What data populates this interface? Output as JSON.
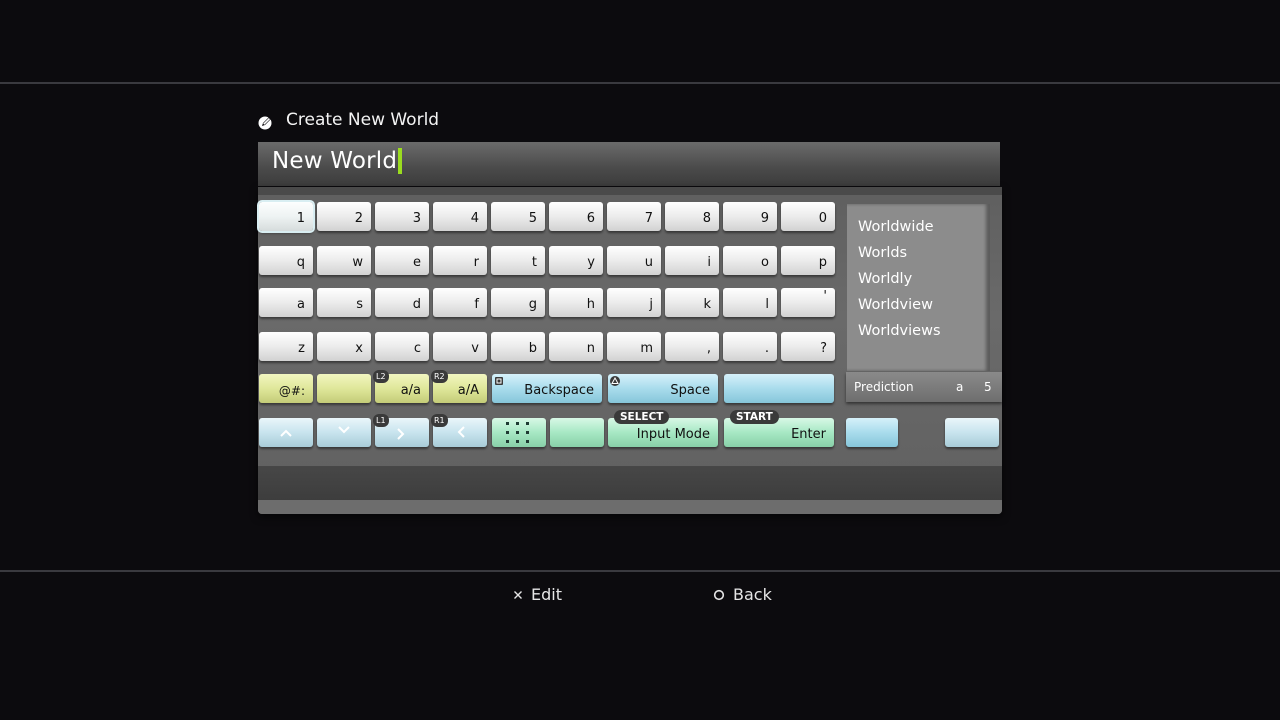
{
  "header": {
    "title": "Create New World",
    "icon": "pencil-icon"
  },
  "text_field": {
    "value": "New World"
  },
  "keyboard": {
    "row1": [
      "1",
      "2",
      "3",
      "4",
      "5",
      "6",
      "7",
      "8",
      "9",
      "0"
    ],
    "row2": [
      "q",
      "w",
      "e",
      "r",
      "t",
      "y",
      "u",
      "i",
      "o",
      "p"
    ],
    "row3": [
      "a",
      "s",
      "d",
      "f",
      "g",
      "h",
      "j",
      "k",
      "l",
      "'"
    ],
    "row4": [
      "z",
      "x",
      "c",
      "v",
      "b",
      "n",
      "m",
      ",",
      ".",
      "?"
    ],
    "symbols_label": "@#:",
    "lower_label": "a/a",
    "upper_label": "a/A",
    "backspace_label": "Backspace",
    "space_label": "Space",
    "input_mode_label": "Input Mode",
    "enter_label": "Enter",
    "badges": {
      "l2": "L2",
      "r2": "R2",
      "l1": "L1",
      "r1": "R1",
      "select": "SELECT",
      "start": "START"
    }
  },
  "prediction": {
    "items": [
      "Worldwide",
      "Worlds",
      "Worldly",
      "Worldview",
      "Worldviews"
    ],
    "label": "Prediction",
    "mode": "a",
    "count": "5"
  },
  "footer": {
    "edit_label": "Edit",
    "back_label": "Back"
  },
  "colors": {
    "background": "#0c0b0e",
    "caret": "#9bdc1f",
    "yellow_key": "#dfe79a",
    "blue_key": "#a9dcec",
    "green_key": "#a7e8c4"
  }
}
